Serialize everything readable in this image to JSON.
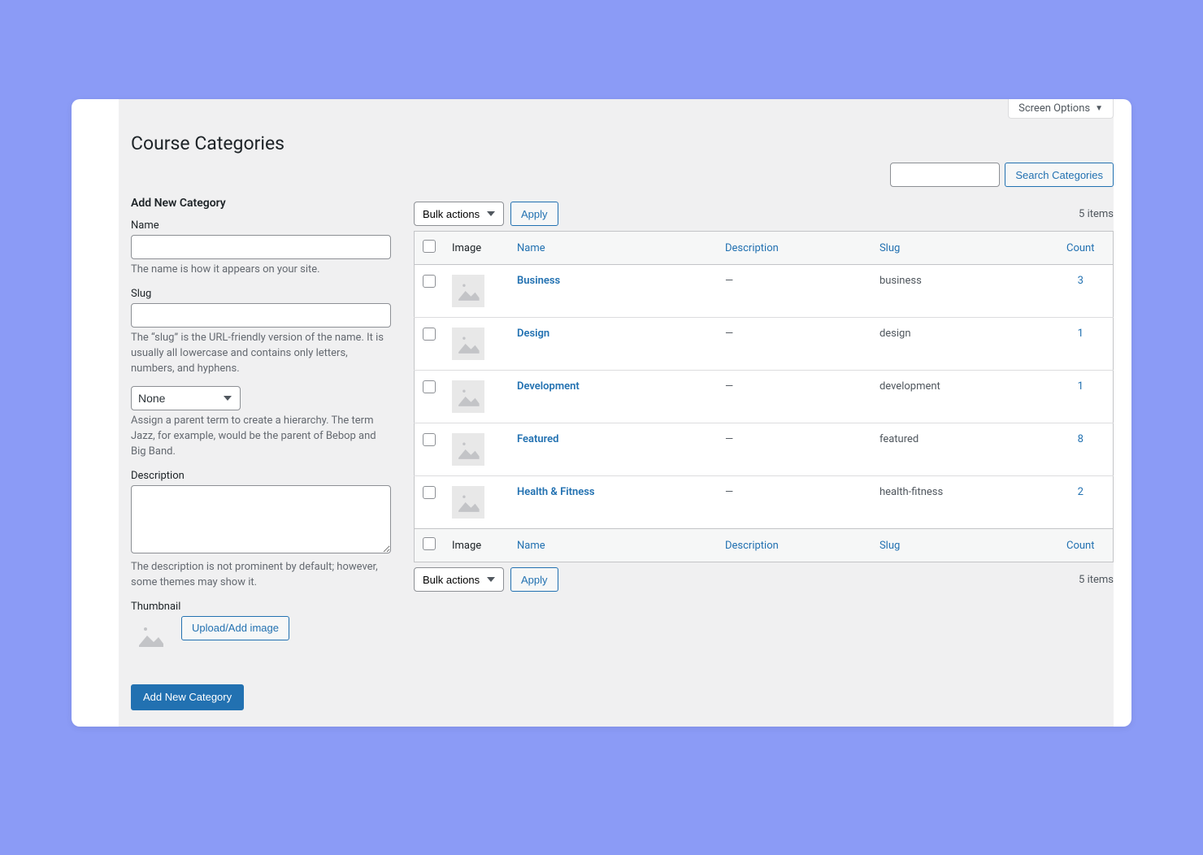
{
  "screen_options_label": "Screen Options",
  "page_title": "Course Categories",
  "search": {
    "button": "Search Categories"
  },
  "form": {
    "title": "Add New Category",
    "name_label": "Name",
    "name_help": "The name is how it appears on your site.",
    "slug_label": "Slug",
    "slug_help": "The “slug” is the URL-friendly version of the name. It is usually all lowercase and contains only letters, numbers, and hyphens.",
    "parent_option_none": "None",
    "parent_help": "Assign a parent term to create a hierarchy. The term Jazz, for example, would be the parent of Bebop and Big Band.",
    "description_label": "Description",
    "description_help": "The description is not prominent by default; however, some themes may show it.",
    "thumbnail_label": "Thumbnail",
    "upload_button": "Upload/Add image",
    "submit_button": "Add New Category"
  },
  "bulk": {
    "default_option": "Bulk actions",
    "apply": "Apply"
  },
  "items_count": "5 items",
  "columns": {
    "image": "Image",
    "name": "Name",
    "description": "Description",
    "slug": "Slug",
    "count": "Count"
  },
  "rows": [
    {
      "name": "Business",
      "description": "—",
      "slug": "business",
      "count": "3"
    },
    {
      "name": "Design",
      "description": "—",
      "slug": "design",
      "count": "1"
    },
    {
      "name": "Development",
      "description": "—",
      "slug": "development",
      "count": "1"
    },
    {
      "name": "Featured",
      "description": "—",
      "slug": "featured",
      "count": "8"
    },
    {
      "name": "Health & Fitness",
      "description": "—",
      "slug": "health-fitness",
      "count": "2"
    }
  ]
}
